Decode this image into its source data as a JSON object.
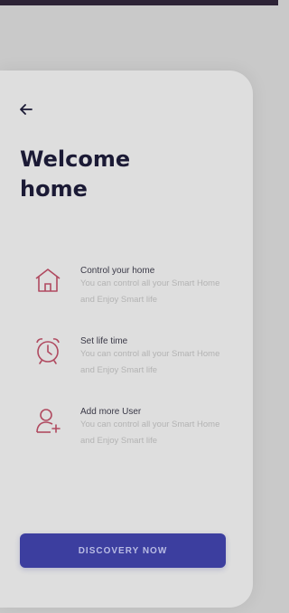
{
  "title": "Welcome home",
  "features": [
    {
      "icon": "house-icon",
      "title": "Control your home",
      "description": "You can control all your Smart Home and Enjoy Smart life"
    },
    {
      "icon": "alarm-clock-icon",
      "title": "Set life time",
      "description": "You can control all your Smart Home and Enjoy Smart life"
    },
    {
      "icon": "add-user-icon",
      "title": "Add more User",
      "description": "You can control all your Smart Home and Enjoy Smart life"
    }
  ],
  "cta_label": "DISCOVERY NOW",
  "colors": {
    "accent": "#3c3e9f",
    "icon": "#b04a60",
    "title": "#1b1a35"
  }
}
